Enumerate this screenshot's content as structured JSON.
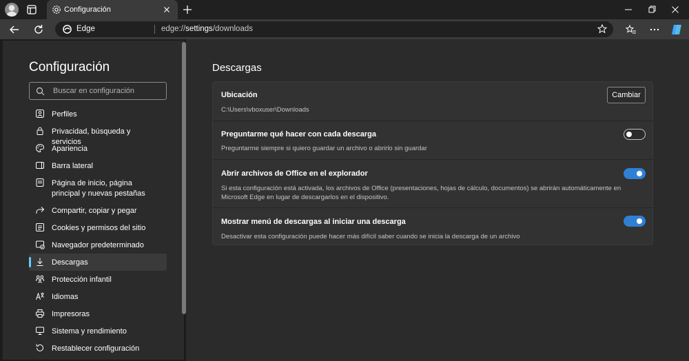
{
  "browser": {
    "tab_title": "Configuración",
    "address_brand": "Edge",
    "url_prefix": "edge://",
    "url_highlight": "settings",
    "url_rest": "/downloads"
  },
  "sidebar": {
    "title": "Configuración",
    "search_placeholder": "Buscar en configuración",
    "items": [
      {
        "label": "Perfiles",
        "icon": "profile-icon"
      },
      {
        "label": "Privacidad, búsqueda y servicios",
        "icon": "lock-icon"
      },
      {
        "label": "Apariencia",
        "icon": "palette-icon"
      },
      {
        "label": "Barra lateral",
        "icon": "sidebar-icon"
      },
      {
        "label": "Página de inicio, página principal y nuevas pestañas",
        "icon": "home-page-icon"
      },
      {
        "label": "Compartir, copiar y pegar",
        "icon": "share-icon"
      },
      {
        "label": "Cookies y permisos del sitio",
        "icon": "permissions-icon"
      },
      {
        "label": "Navegador predeterminado",
        "icon": "default-browser-icon"
      },
      {
        "label": "Descargas",
        "icon": "download-icon",
        "active": true
      },
      {
        "label": "Protección infantil",
        "icon": "family-icon"
      },
      {
        "label": "Idiomas",
        "icon": "language-icon"
      },
      {
        "label": "Impresoras",
        "icon": "printer-icon"
      },
      {
        "label": "Sistema y rendimiento",
        "icon": "system-icon"
      },
      {
        "label": "Restablecer configuración",
        "icon": "reset-icon"
      }
    ]
  },
  "main": {
    "title": "Descargas",
    "location": {
      "title": "Ubicación",
      "path": "C:\\Users\\vboxuser\\Downloads",
      "button": "Cambiar"
    },
    "settings": [
      {
        "title": "Preguntarme qué hacer con cada descarga",
        "description": "Preguntarme siempre si quiero guardar un archivo o abrirlo sin guardar",
        "enabled": false
      },
      {
        "title": "Abrir archivos de Office en el explorador",
        "description": "Si esta configuración está activada, los archivos de Office (presentaciones, hojas de cálculo, documentos) se abrirán automáticamente en Microsoft Edge en lugar de descargarlos en el dispositivo.",
        "enabled": true
      },
      {
        "title": "Mostrar menú de descargas al iniciar una descarga",
        "description": "Desactivar esta configuración puede hacer más difícil saber cuando se inicia la descarga de un archivo",
        "enabled": true
      }
    ]
  },
  "colors": {
    "accent": "#60cdff",
    "toggle_on": "#2f80d4",
    "background": "#202020",
    "panel": "#2b2b2b",
    "card": "#323232"
  }
}
